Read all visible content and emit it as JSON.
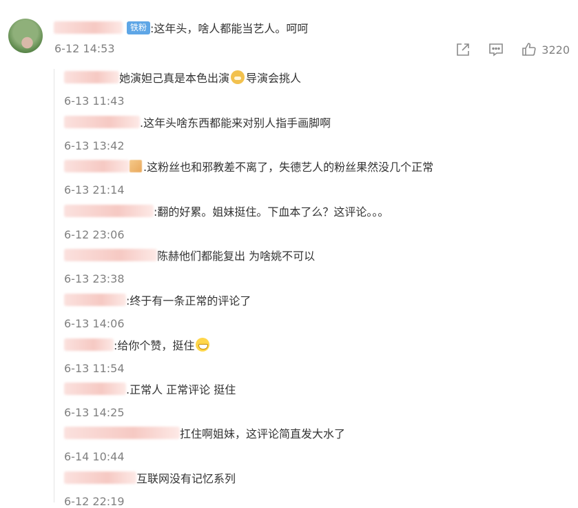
{
  "comment": {
    "badge": "铁粉",
    "text": ":这年头，啥人都能当艺人。呵呵",
    "time": "6-12 14:53",
    "like_count": "3220"
  },
  "actions": {
    "share_icon": "share-icon",
    "comment_icon": "comment-icon",
    "like_icon": "like-icon"
  },
  "replies": [
    {
      "text": "她演妲己真是本色出演",
      "emoji": "doge-emoji",
      "text_after": "导演会挑人",
      "time": "6-13 11:43"
    },
    {
      "text": ".这年头啥东西都能来对别人指手画脚啊",
      "time": "6-13 13:42"
    },
    {
      "text": ".这粉丝也和邪教差不离了，失德艺人的粉丝果然没几个正常",
      "time": "6-13 21:14"
    },
    {
      "text": ":翻的好累。姐妹挺住。下血本了么？这评论。。。",
      "time": "6-12 23:06"
    },
    {
      "text": "陈赫他们都能复出 为啥姚不可以",
      "time": "6-13 23:38"
    },
    {
      "text": ":终于有一条正常的评论了",
      "time": "6-13 14:06"
    },
    {
      "text": ":给你个赞，挺住",
      "emoji": "grin-emoji",
      "time": "6-13 11:54"
    },
    {
      "text": ".正常人 正常评论 挺住",
      "time": "6-13 14:25"
    },
    {
      "text": "扛住啊姐妹，这评论简直发大水了",
      "time": "6-14 10:44"
    },
    {
      "text": "互联网没有记忆系列",
      "time": "6-12 22:19"
    }
  ]
}
